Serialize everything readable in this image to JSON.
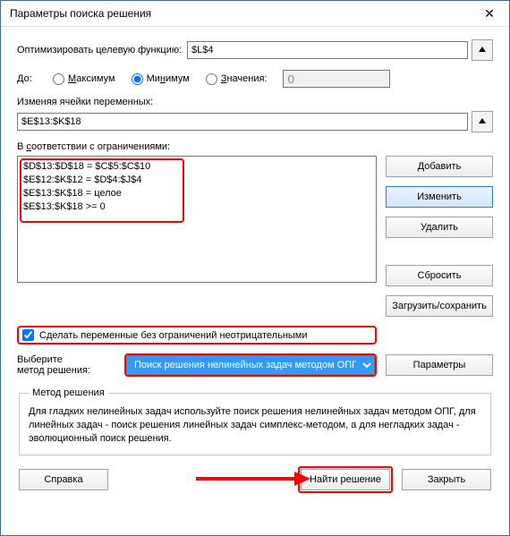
{
  "window": {
    "title": "Параметры поиска решения"
  },
  "objective": {
    "label": "Оптимизировать целевую функцию:",
    "value": "$L$4"
  },
  "to_label": "До:",
  "radios": {
    "max": "Максимум",
    "min": "Минимум",
    "value": "Значения:",
    "value_input": "0",
    "selected": "min"
  },
  "vars": {
    "label": "Изменяя ячейки переменных:",
    "value": "$E$13:$K$18"
  },
  "constraints": {
    "label": "В соответствии с ограничениями:",
    "lines": [
      "$D$13:$D$18 = $C$5:$C$10",
      "$E$12:$K$12 = $D$4:$J$4",
      "$E$13:$K$18 = целое",
      "$E$13:$K$18 >= 0"
    ]
  },
  "buttons": {
    "add": "Добавить",
    "change": "Изменить",
    "delete": "Удалить",
    "reset": "Сбросить",
    "loadsave": "Загрузить/сохранить",
    "params": "Параметры",
    "help": "Справка",
    "solve": "Найти решение",
    "close": "Закрыть"
  },
  "nonneg": {
    "label": "Сделать переменные без ограничений неотрицательными",
    "checked": true
  },
  "method": {
    "label": "Выберите метод решения:",
    "selected": "Поиск решения нелинейных задач методом ОПГ"
  },
  "desc": {
    "title": "Метод решения",
    "text": "Для гладких нелинейных задач используйте поиск решения нелинейных задач методом ОПГ, для линейных задач - поиск решения линейных задач симплекс-методом, а для негладких задач - эволюционный поиск решения."
  }
}
